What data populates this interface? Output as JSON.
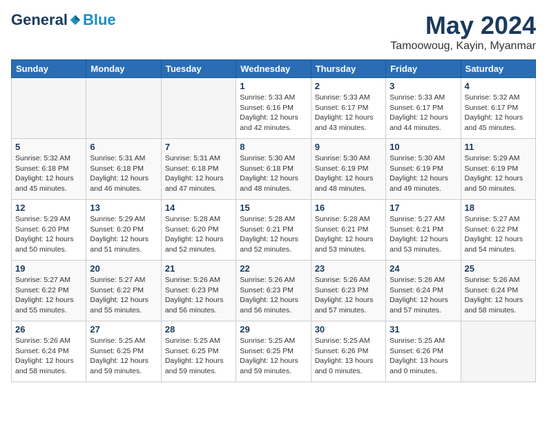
{
  "header": {
    "logo_general": "General",
    "logo_blue": "Blue",
    "month": "May 2024",
    "location": "Tamoowoug, Kayin, Myanmar"
  },
  "days_of_week": [
    "Sunday",
    "Monday",
    "Tuesday",
    "Wednesday",
    "Thursday",
    "Friday",
    "Saturday"
  ],
  "weeks": [
    [
      {
        "day": "",
        "info": ""
      },
      {
        "day": "",
        "info": ""
      },
      {
        "day": "",
        "info": ""
      },
      {
        "day": "1",
        "info": "Sunrise: 5:33 AM\nSunset: 6:16 PM\nDaylight: 12 hours\nand 42 minutes."
      },
      {
        "day": "2",
        "info": "Sunrise: 5:33 AM\nSunset: 6:17 PM\nDaylight: 12 hours\nand 43 minutes."
      },
      {
        "day": "3",
        "info": "Sunrise: 5:33 AM\nSunset: 6:17 PM\nDaylight: 12 hours\nand 44 minutes."
      },
      {
        "day": "4",
        "info": "Sunrise: 5:32 AM\nSunset: 6:17 PM\nDaylight: 12 hours\nand 45 minutes."
      }
    ],
    [
      {
        "day": "5",
        "info": "Sunrise: 5:32 AM\nSunset: 6:18 PM\nDaylight: 12 hours\nand 45 minutes."
      },
      {
        "day": "6",
        "info": "Sunrise: 5:31 AM\nSunset: 6:18 PM\nDaylight: 12 hours\nand 46 minutes."
      },
      {
        "day": "7",
        "info": "Sunrise: 5:31 AM\nSunset: 6:18 PM\nDaylight: 12 hours\nand 47 minutes."
      },
      {
        "day": "8",
        "info": "Sunrise: 5:30 AM\nSunset: 6:18 PM\nDaylight: 12 hours\nand 48 minutes."
      },
      {
        "day": "9",
        "info": "Sunrise: 5:30 AM\nSunset: 6:19 PM\nDaylight: 12 hours\nand 48 minutes."
      },
      {
        "day": "10",
        "info": "Sunrise: 5:30 AM\nSunset: 6:19 PM\nDaylight: 12 hours\nand 49 minutes."
      },
      {
        "day": "11",
        "info": "Sunrise: 5:29 AM\nSunset: 6:19 PM\nDaylight: 12 hours\nand 50 minutes."
      }
    ],
    [
      {
        "day": "12",
        "info": "Sunrise: 5:29 AM\nSunset: 6:20 PM\nDaylight: 12 hours\nand 50 minutes."
      },
      {
        "day": "13",
        "info": "Sunrise: 5:29 AM\nSunset: 6:20 PM\nDaylight: 12 hours\nand 51 minutes."
      },
      {
        "day": "14",
        "info": "Sunrise: 5:28 AM\nSunset: 6:20 PM\nDaylight: 12 hours\nand 52 minutes."
      },
      {
        "day": "15",
        "info": "Sunrise: 5:28 AM\nSunset: 6:21 PM\nDaylight: 12 hours\nand 52 minutes."
      },
      {
        "day": "16",
        "info": "Sunrise: 5:28 AM\nSunset: 6:21 PM\nDaylight: 12 hours\nand 53 minutes."
      },
      {
        "day": "17",
        "info": "Sunrise: 5:27 AM\nSunset: 6:21 PM\nDaylight: 12 hours\nand 53 minutes."
      },
      {
        "day": "18",
        "info": "Sunrise: 5:27 AM\nSunset: 6:22 PM\nDaylight: 12 hours\nand 54 minutes."
      }
    ],
    [
      {
        "day": "19",
        "info": "Sunrise: 5:27 AM\nSunset: 6:22 PM\nDaylight: 12 hours\nand 55 minutes."
      },
      {
        "day": "20",
        "info": "Sunrise: 5:27 AM\nSunset: 6:22 PM\nDaylight: 12 hours\nand 55 minutes."
      },
      {
        "day": "21",
        "info": "Sunrise: 5:26 AM\nSunset: 6:23 PM\nDaylight: 12 hours\nand 56 minutes."
      },
      {
        "day": "22",
        "info": "Sunrise: 5:26 AM\nSunset: 6:23 PM\nDaylight: 12 hours\nand 56 minutes."
      },
      {
        "day": "23",
        "info": "Sunrise: 5:26 AM\nSunset: 6:23 PM\nDaylight: 12 hours\nand 57 minutes."
      },
      {
        "day": "24",
        "info": "Sunrise: 5:26 AM\nSunset: 6:24 PM\nDaylight: 12 hours\nand 57 minutes."
      },
      {
        "day": "25",
        "info": "Sunrise: 5:26 AM\nSunset: 6:24 PM\nDaylight: 12 hours\nand 58 minutes."
      }
    ],
    [
      {
        "day": "26",
        "info": "Sunrise: 5:26 AM\nSunset: 6:24 PM\nDaylight: 12 hours\nand 58 minutes."
      },
      {
        "day": "27",
        "info": "Sunrise: 5:25 AM\nSunset: 6:25 PM\nDaylight: 12 hours\nand 59 minutes."
      },
      {
        "day": "28",
        "info": "Sunrise: 5:25 AM\nSunset: 6:25 PM\nDaylight: 12 hours\nand 59 minutes."
      },
      {
        "day": "29",
        "info": "Sunrise: 5:25 AM\nSunset: 6:25 PM\nDaylight: 12 hours\nand 59 minutes."
      },
      {
        "day": "30",
        "info": "Sunrise: 5:25 AM\nSunset: 6:26 PM\nDaylight: 13 hours\nand 0 minutes."
      },
      {
        "day": "31",
        "info": "Sunrise: 5:25 AM\nSunset: 6:26 PM\nDaylight: 13 hours\nand 0 minutes."
      },
      {
        "day": "",
        "info": ""
      }
    ]
  ]
}
